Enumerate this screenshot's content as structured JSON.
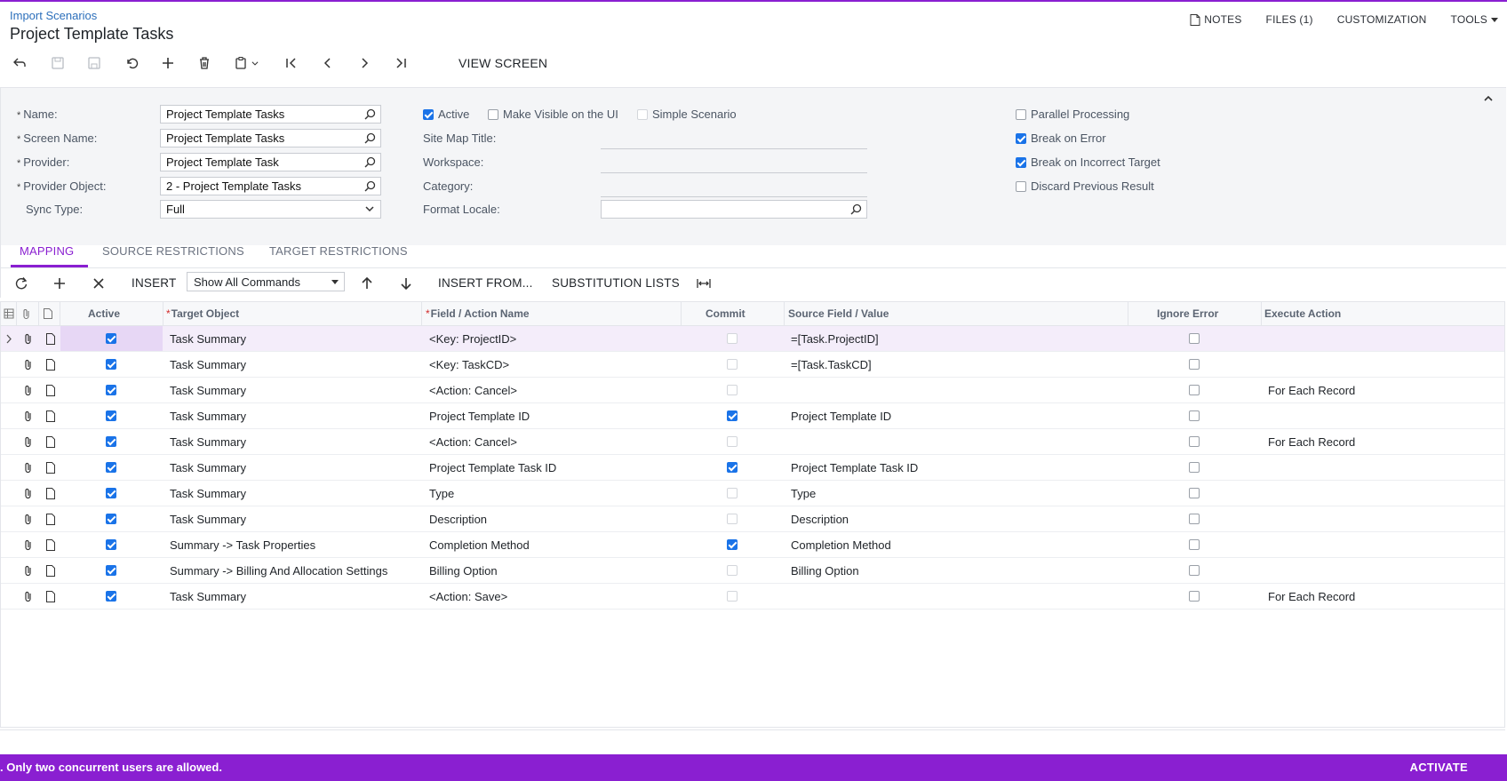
{
  "header": {
    "breadcrumb": "Import Scenarios",
    "title": "Project Template Tasks",
    "links": {
      "notes": "NOTES",
      "files": "FILES (1)",
      "customization": "CUSTOMIZATION",
      "tools": "TOOLS"
    }
  },
  "toolbar": {
    "view_screen": "VIEW SCREEN"
  },
  "form": {
    "name_label": "Name:",
    "name_value": "Project Template Tasks",
    "screen_label": "Screen Name:",
    "screen_value": "Project Template Tasks",
    "provider_label": "Provider:",
    "provider_value": "Project Template Task",
    "provider_obj_label": "Provider Object:",
    "provider_obj_value": "2 - Project Template Tasks",
    "sync_label": "Sync Type:",
    "sync_value": "Full",
    "active_label": "Active",
    "active_checked": true,
    "visible_label": "Make Visible on the UI",
    "visible_checked": false,
    "simple_label": "Simple Scenario",
    "simple_checked": false,
    "sitemap_label": "Site Map Title:",
    "workspace_label": "Workspace:",
    "category_label": "Category:",
    "locale_label": "Format Locale:",
    "locale_value": "",
    "parallel_label": "Parallel Processing",
    "parallel_checked": false,
    "break_error_label": "Break on Error",
    "break_error_checked": true,
    "break_target_label": "Break on Incorrect Target",
    "break_target_checked": true,
    "discard_label": "Discard Previous Result",
    "discard_checked": false
  },
  "tabs": {
    "mapping": "MAPPING",
    "source": "SOURCE RESTRICTIONS",
    "target": "TARGET RESTRICTIONS"
  },
  "grid_toolbar": {
    "insert": "INSERT",
    "filter_value": "Show All Commands",
    "insert_from": "INSERT FROM...",
    "substitution": "SUBSTITUTION LISTS"
  },
  "columns": {
    "active": "Active",
    "target": "Target Object",
    "field": "Field / Action Name",
    "commit": "Commit",
    "source": "Source Field / Value",
    "ignore": "Ignore Error",
    "execute": "Execute Action"
  },
  "rows": [
    {
      "target": "Task Summary",
      "field": "<Key: ProjectID>",
      "commit": false,
      "source": "=[Task.ProjectID]",
      "execute": ""
    },
    {
      "target": "Task Summary",
      "field": "<Key: TaskCD>",
      "commit": false,
      "source": "=[Task.TaskCD]",
      "execute": ""
    },
    {
      "target": "Task Summary",
      "field": "<Action: Cancel>",
      "commit": false,
      "source": "",
      "execute": "For Each Record"
    },
    {
      "target": "Task Summary",
      "field": "Project Template ID",
      "commit": true,
      "source": "Project Template ID",
      "execute": ""
    },
    {
      "target": "Task Summary",
      "field": "<Action: Cancel>",
      "commit": false,
      "source": "",
      "execute": "For Each Record"
    },
    {
      "target": "Task Summary",
      "field": "Project Template Task ID",
      "commit": true,
      "source": "Project Template Task ID",
      "execute": ""
    },
    {
      "target": "Task Summary",
      "field": "Type",
      "commit": false,
      "source": "Type",
      "execute": ""
    },
    {
      "target": "Task Summary",
      "field": "Description",
      "commit": false,
      "source": "Description",
      "execute": ""
    },
    {
      "target": "Summary -> Task Properties",
      "field": "Completion Method",
      "commit": true,
      "source": "Completion Method",
      "execute": ""
    },
    {
      "target": "Summary -> Billing And Allocation Settings",
      "field": "Billing Option",
      "commit": false,
      "source": "Billing Option",
      "execute": ""
    },
    {
      "target": "Task Summary",
      "field": "<Action: Save>",
      "commit": false,
      "source": "",
      "execute": "For Each Record"
    }
  ],
  "footer": {
    "message": ". Only two concurrent users are allowed.",
    "activate": "ACTIVATE"
  },
  "colors": {
    "accent": "#8a1fd1",
    "checkbox": "#1a73e8",
    "link": "#2c6fbb"
  }
}
